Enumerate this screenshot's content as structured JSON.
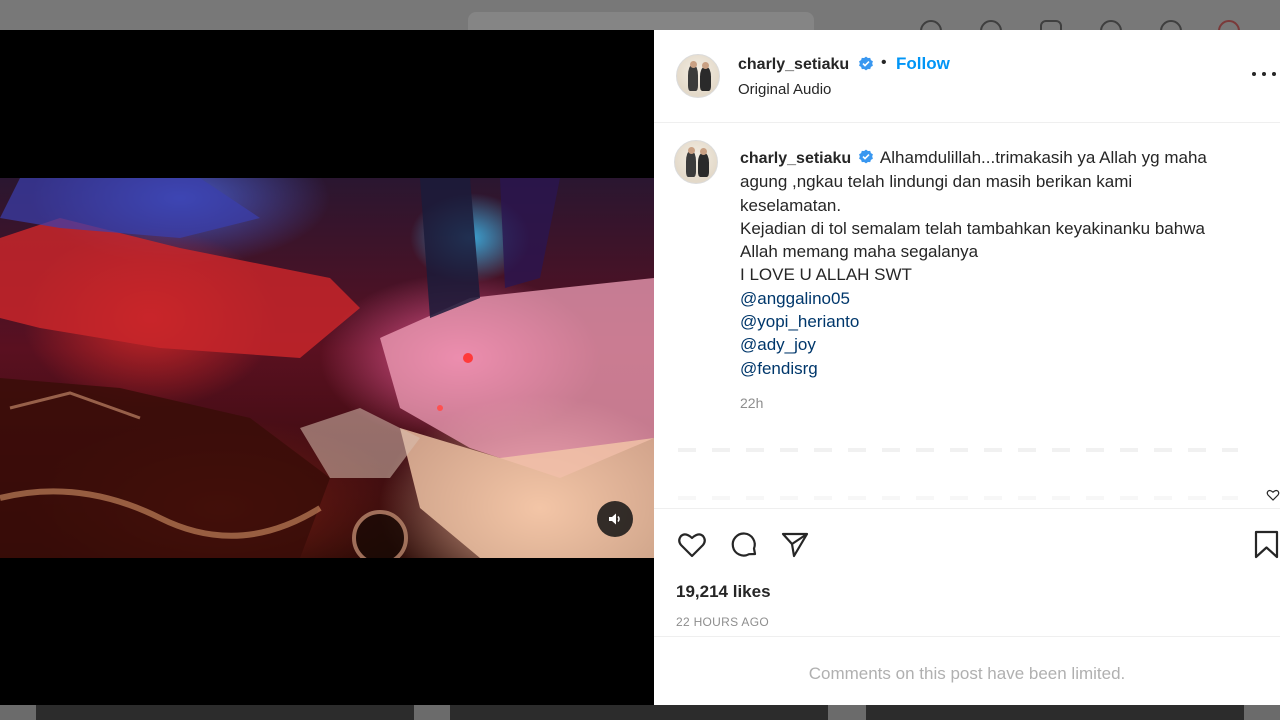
{
  "post": {
    "username": "charly_setiaku",
    "follow_label": "Follow",
    "separator": "•",
    "subtitle": "Original Audio",
    "caption_lines": [
      "Alhamdulillah...trimakasih ya Allah yg maha",
      "agung ,ngkau telah lindungi dan masih berikan kami",
      "keselamatan.",
      "Kejadian di tol semalam telah tambahkan keyakinanku bahwa",
      "Allah memang maha segalanya",
      "I LOVE U ALLAH SWT"
    ],
    "mentions": [
      "@anggalino05",
      "@yopi_herianto",
      "@ady_joy",
      "@fendisrg"
    ],
    "caption_time": "22h",
    "likes": "19,214 likes",
    "posted": "22 HOURS AGO",
    "comments_limited": "Comments on this post have been limited."
  },
  "icons": {
    "verified": "verified-badge-icon",
    "more": "more-options-icon",
    "like": "heart-icon",
    "comment": "comment-icon",
    "share": "paper-plane-icon",
    "save": "bookmark-icon",
    "mute": "speaker-icon"
  },
  "colors": {
    "accent": "#0095f6",
    "mention": "#00376b",
    "verified": "#3897f0",
    "muted_text": "#8e8e8e"
  }
}
